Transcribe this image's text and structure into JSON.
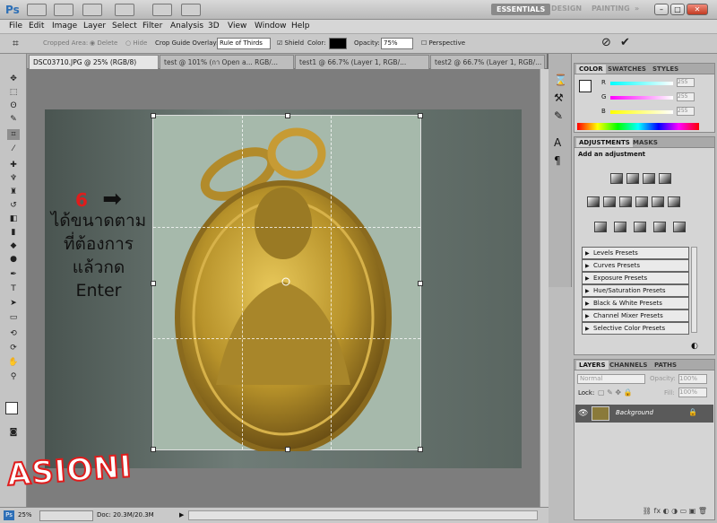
{
  "app": {
    "logo": "Ps"
  },
  "workspaces": {
    "essentials": "ESSENTIALS",
    "design": "DESIGN",
    "painting": "PAINTING"
  },
  "window_buttons": {
    "minimize": "–",
    "maximize": "□",
    "close": "✕"
  },
  "menu": [
    "File",
    "Edit",
    "Image",
    "Layer",
    "Select",
    "Filter",
    "Analysis",
    "3D",
    "View",
    "Window",
    "Help"
  ],
  "options": {
    "cropped_area": "Cropped Area:",
    "delete": "Delete",
    "hide": "Hide",
    "guide_overlay": "Crop Guide Overlay:",
    "guide_value": "Rule of Thirds",
    "shield": "Shield",
    "color": "Color:",
    "opacity": "Opacity:",
    "opacity_value": "75%",
    "perspective": "Perspective",
    "cancel_icon": "⊘",
    "commit_icon": "✔"
  },
  "tabs": [
    {
      "label": "DSC03710.JPG @ 25% (RGB/8)"
    },
    {
      "label": "test @ 101% (กา Open a... RGB/..."
    },
    {
      "label": "test1 @ 66.7% (Layer 1, RGB/..."
    },
    {
      "label": "test2 @ 66.7% (Layer 1, RGB/..."
    }
  ],
  "overlay": {
    "step": "6",
    "arrow": "➡",
    "line1": "ได้ขนาดตาม",
    "line2": "ที่ต้องการ",
    "line3": "แล้วกด",
    "line4": "Enter"
  },
  "watermark": "ASIONI",
  "status": {
    "zoom": "25%",
    "doc": "Doc: 20.3M/20.3M"
  },
  "color_panel": {
    "tabs": [
      "COLOR",
      "SWATCHES",
      "STYLES"
    ],
    "channels": [
      {
        "name": "R",
        "value": "255"
      },
      {
        "name": "G",
        "value": "255"
      },
      {
        "name": "B",
        "value": "255"
      }
    ]
  },
  "adjustments": {
    "tabs": [
      "ADJUSTMENTS",
      "MASKS"
    ],
    "subtitle": "Add an adjustment",
    "presets": [
      "Levels Presets",
      "Curves Presets",
      "Exposure Presets",
      "Hue/Saturation Presets",
      "Black & White Presets",
      "Channel Mixer Presets",
      "Selective Color Presets"
    ]
  },
  "layers": {
    "tabs": [
      "LAYERS",
      "CHANNELS",
      "PATHS"
    ],
    "blend": "Normal",
    "opacity_label": "Opacity:",
    "opacity_value": "100%",
    "lock_label": "Lock:",
    "fill_label": "Fill:",
    "fill_value": "100%",
    "layer_name": "Background"
  },
  "colors": {
    "accent": "#e01c1c",
    "panel": "#d5d5d5"
  }
}
